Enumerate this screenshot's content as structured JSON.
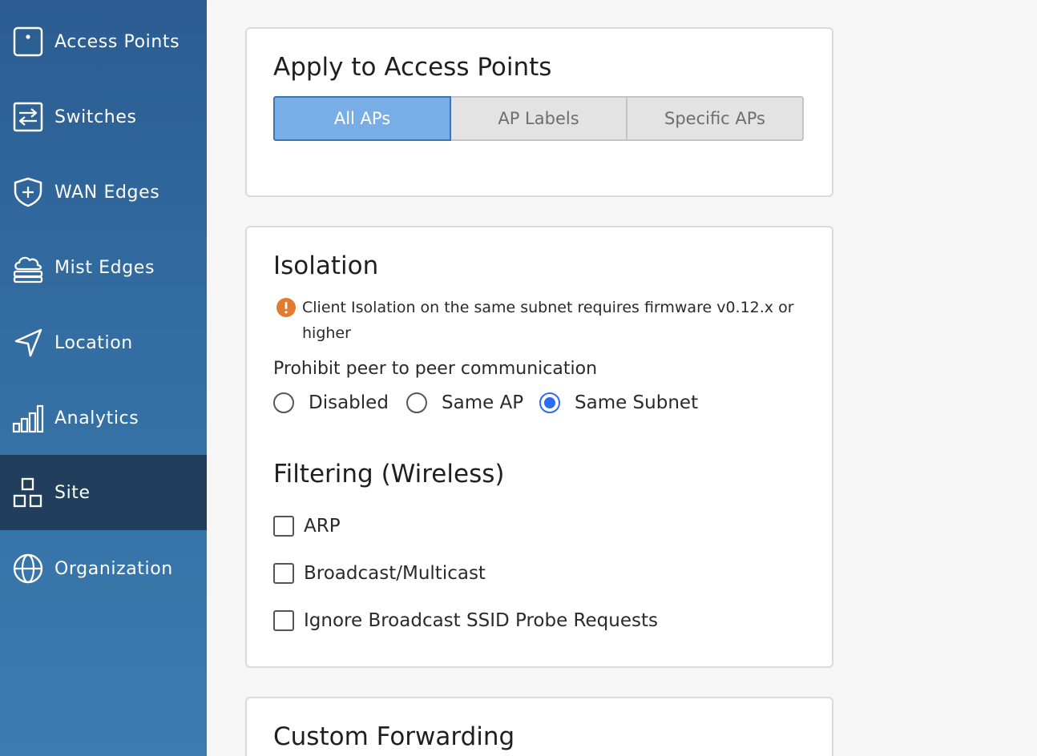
{
  "sidebar": {
    "items": [
      {
        "label": "Access Points",
        "icon": "access-point-icon"
      },
      {
        "label": "Switches",
        "icon": "switch-icon"
      },
      {
        "label": "WAN Edges",
        "icon": "shield-plus-icon"
      },
      {
        "label": "Mist Edges",
        "icon": "cloud-icon"
      },
      {
        "label": "Location",
        "icon": "location-arrow-icon"
      },
      {
        "label": "Analytics",
        "icon": "bar-chart-icon"
      },
      {
        "label": "Site",
        "icon": "site-icon",
        "active": true
      },
      {
        "label": "Organization",
        "icon": "globe-icon"
      }
    ]
  },
  "apply_card": {
    "title": "Apply to Access Points",
    "options": [
      "All APs",
      "AP Labels",
      "Specific APs"
    ],
    "selected": "All APs"
  },
  "isolation_card": {
    "title": "Isolation",
    "warning": "Client Isolation on the same subnet requires firmware v0.12.x or higher",
    "peer_label": "Prohibit peer to peer communication",
    "radios": [
      "Disabled",
      "Same AP",
      "Same Subnet"
    ],
    "radio_selected": "Same Subnet",
    "filtering_title": "Filtering (Wireless)",
    "checkboxes": [
      "ARP",
      "Broadcast/Multicast",
      "Ignore Broadcast SSID Probe Requests"
    ]
  },
  "forwarding_card": {
    "title": "Custom Forwarding"
  },
  "colors": {
    "sidebar_active": "#213f5d",
    "segment_selected": "#79ade6",
    "radio_accent": "#2b6cf0",
    "warning": "#e07b2f"
  }
}
